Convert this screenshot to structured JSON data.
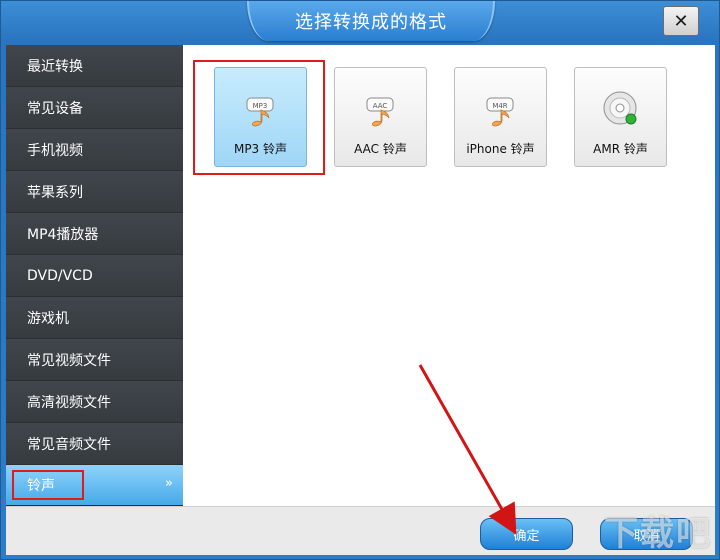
{
  "window": {
    "title": "选择转换成的格式",
    "close_label": "✕"
  },
  "sidebar": {
    "items": [
      {
        "label": "最近转换"
      },
      {
        "label": "常见设备"
      },
      {
        "label": "手机视频"
      },
      {
        "label": "苹果系列"
      },
      {
        "label": "MP4播放器"
      },
      {
        "label": "DVD/VCD"
      },
      {
        "label": "游戏机"
      },
      {
        "label": "常见视频文件"
      },
      {
        "label": "高清视频文件"
      },
      {
        "label": "常见音频文件"
      },
      {
        "label": "铃声",
        "active": true,
        "chevron": "»"
      }
    ]
  },
  "formats": [
    {
      "label": "MP3 铃声",
      "badge": "MP3",
      "icon": "music-note-icon",
      "selected": true
    },
    {
      "label": "AAC 铃声",
      "badge": "AAC",
      "icon": "music-note-icon"
    },
    {
      "label": "iPhone 铃声",
      "badge": "M4R",
      "icon": "music-note-icon"
    },
    {
      "label": "AMR 铃声",
      "icon": "disc-icon"
    }
  ],
  "footer": {
    "ok_label": "确定",
    "cancel_label": "取消"
  },
  "watermark": {
    "text": "下载吧"
  },
  "colors": {
    "accent": "#2a7ed0",
    "annotation": "#e01b1b",
    "sidebar": "#3a3f44"
  }
}
